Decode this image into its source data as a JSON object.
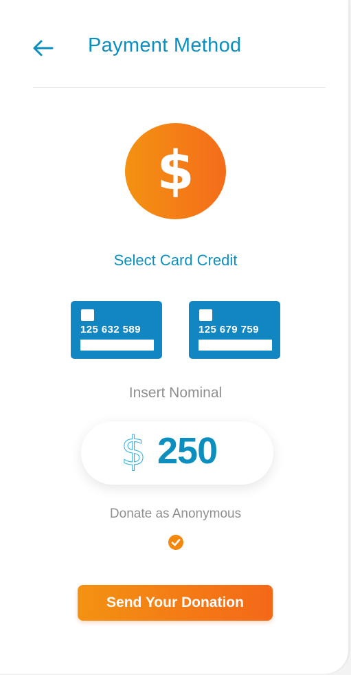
{
  "header": {
    "title": "Payment Method",
    "back_icon": "arrow-left-icon"
  },
  "badge": {
    "icon": "dollar-icon",
    "symbol": "$"
  },
  "cards_section": {
    "title": "Select Card Credit",
    "cards": [
      {
        "number": "125 632 589"
      },
      {
        "number": "125 679 759"
      }
    ]
  },
  "nominal": {
    "label": "Insert Nominal",
    "currency_symbol": "$",
    "value": "250"
  },
  "anonymous": {
    "label": "Donate as Anonymous",
    "checked": true,
    "icon": "check-icon"
  },
  "submit": {
    "label": "Send Your Donation"
  },
  "colors": {
    "primary": "#0c8fbe",
    "card": "#1186c0",
    "accent_start": "#f39212",
    "accent_end": "#f46818",
    "muted_text": "#8e8e8e"
  }
}
